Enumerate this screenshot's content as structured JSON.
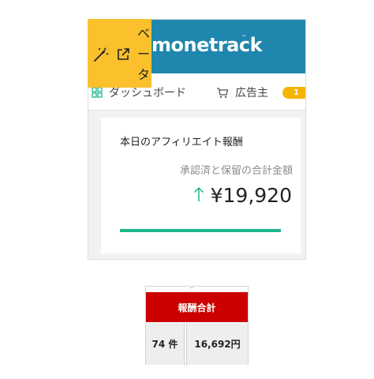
{
  "brand": {
    "name": "monetrack",
    "tm": "™"
  },
  "toolbar": {
    "beta_chars": [
      "ベ",
      "ー",
      "タ"
    ],
    "wand_icon": "magic-wand-icon",
    "link_icon": "external-link-icon",
    "color": "#fbc12c"
  },
  "nav": {
    "dashboard": {
      "label": "ダッシュボード",
      "icon": "dashboard-icon"
    },
    "advertiser": {
      "label": "広告主",
      "icon": "cart-icon"
    },
    "badge": "1"
  },
  "card": {
    "title": "本日のアフィリエイト報酬",
    "subtitle": "承認済と保留の合計金額",
    "amount": "¥19,920",
    "trend_icon": "arrow-up-icon",
    "progress": 1.0,
    "accent": "#1eb68d"
  },
  "reward_table": {
    "header": "報酬合計",
    "count": "74 件",
    "amount": "16,692円",
    "header_color": "#cc0000"
  },
  "colors": {
    "header_bg": "#1f86ad",
    "badge": "#f5b400"
  }
}
